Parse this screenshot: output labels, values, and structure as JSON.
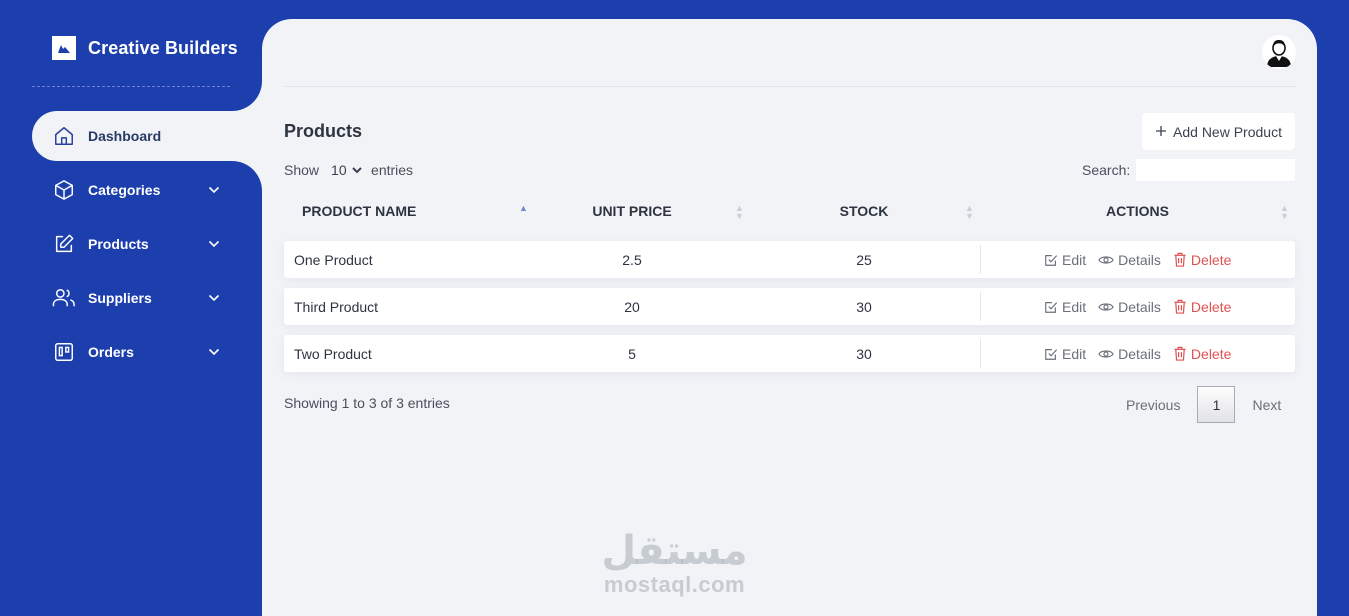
{
  "brand": {
    "name": "Creative Builders"
  },
  "sidebar": {
    "items": [
      {
        "label": "Dashboard",
        "icon": "home-icon",
        "active": true
      },
      {
        "label": "Categories",
        "icon": "box-icon"
      },
      {
        "label": "Products",
        "icon": "edit-icon"
      },
      {
        "label": "Suppliers",
        "icon": "users-icon"
      },
      {
        "label": "Orders",
        "icon": "trello-icon"
      }
    ]
  },
  "page": {
    "title": "Products",
    "add_button": "Add New Product"
  },
  "table_controls": {
    "show_label": "Show",
    "length_value": "10",
    "entries_label": "entries",
    "search_label": "Search:",
    "search_value": ""
  },
  "table": {
    "headers": [
      "PRODUCT NAME",
      "UNIT PRICE",
      "STOCK",
      "ACTIONS"
    ],
    "rows": [
      {
        "name": "One Product",
        "price": "2.5",
        "stock": "25"
      },
      {
        "name": "Third Product",
        "price": "20",
        "stock": "30"
      },
      {
        "name": "Two Product",
        "price": "5",
        "stock": "30"
      }
    ],
    "actions": {
      "edit": "Edit",
      "details": "Details",
      "delete": "Delete"
    }
  },
  "footer": {
    "info": "Showing 1 to 3 of 3 entries",
    "previous": "Previous",
    "current_page": "1",
    "next": "Next"
  },
  "watermark": {
    "arabic": "مستقل",
    "latin": "mostaql.com"
  },
  "colors": {
    "sidebar_bg": "#1d3fae",
    "content_bg": "#f1f3f7",
    "delete": "#e05252"
  }
}
